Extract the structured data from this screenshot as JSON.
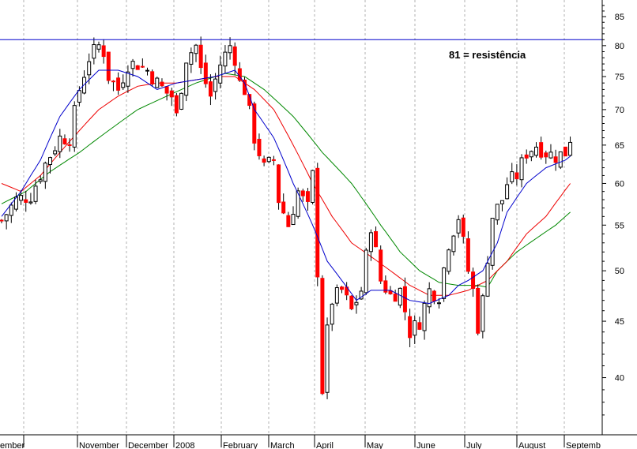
{
  "chart_data": {
    "type": "candlestick",
    "title": "",
    "xlabel": "",
    "ylabel": "",
    "y_scale": "log",
    "ylim": [
      35.5,
      88
    ],
    "grid": {
      "vertical": true,
      "horizontal": false
    },
    "y_ticks": [
      40,
      45,
      50,
      55,
      60,
      65,
      70,
      75,
      80,
      85
    ],
    "x_labels": [
      "ember",
      "November",
      "December",
      "2008",
      "February",
      "March",
      "April",
      "May",
      "June",
      "July",
      "August",
      "Septemb"
    ],
    "resistance": {
      "value": 81,
      "color": "#0000cc"
    },
    "annotation": "81 = resistência",
    "colors": {
      "up": "#ffffff",
      "down": "#ff0000",
      "candle_outline": "#000000",
      "ma_short": "#0000cc",
      "ma_mid": "#ee0000",
      "ma_long": "#008800"
    },
    "close_path": [
      [
        0,
        55.5
      ],
      [
        3,
        58
      ],
      [
        6,
        58.5
      ],
      [
        9,
        62.5
      ],
      [
        12,
        66
      ],
      [
        14,
        66
      ],
      [
        16,
        73
      ],
      [
        18,
        78
      ],
      [
        20,
        80
      ],
      [
        21,
        79
      ],
      [
        22,
        75
      ],
      [
        24,
        73
      ],
      [
        26,
        77
      ],
      [
        28,
        77
      ],
      [
        30,
        76
      ],
      [
        32,
        74
      ],
      [
        34,
        72.5
      ],
      [
        35,
        72
      ],
      [
        36,
        69
      ],
      [
        38,
        78
      ],
      [
        40,
        80
      ],
      [
        41,
        76
      ],
      [
        43,
        72
      ],
      [
        45,
        77
      ],
      [
        47,
        80
      ],
      [
        48,
        78
      ],
      [
        49,
        74
      ],
      [
        50,
        73
      ],
      [
        52,
        66
      ],
      [
        54,
        62
      ],
      [
        56,
        63
      ],
      [
        57,
        58
      ],
      [
        59,
        55
      ],
      [
        61,
        59
      ],
      [
        63,
        57
      ],
      [
        64,
        61
      ],
      [
        65,
        50
      ],
      [
        66,
        39
      ],
      [
        67,
        44
      ],
      [
        68,
        47
      ],
      [
        70,
        48
      ],
      [
        72,
        46
      ],
      [
        74,
        48
      ],
      [
        76,
        55
      ],
      [
        78,
        49
      ],
      [
        80,
        47.5
      ],
      [
        82,
        48
      ],
      [
        84,
        44
      ],
      [
        86,
        45
      ],
      [
        88,
        48
      ],
      [
        90,
        47.5
      ],
      [
        92,
        53
      ],
      [
        94,
        56
      ],
      [
        96,
        50
      ],
      [
        97,
        48
      ],
      [
        98,
        44.5
      ],
      [
        99,
        47
      ],
      [
        101,
        56
      ],
      [
        103,
        58
      ],
      [
        104,
        60
      ],
      [
        106,
        61
      ],
      [
        108,
        64
      ],
      [
        110,
        65
      ],
      [
        112,
        64
      ],
      [
        114,
        63.5
      ],
      [
        116,
        64
      ],
      [
        117,
        66
      ]
    ],
    "ma_short_path": [
      [
        0,
        56
      ],
      [
        4,
        59
      ],
      [
        8,
        63
      ],
      [
        12,
        69
      ],
      [
        16,
        73
      ],
      [
        20,
        76
      ],
      [
        24,
        76
      ],
      [
        28,
        75
      ],
      [
        32,
        73
      ],
      [
        36,
        74
      ],
      [
        40,
        74.5
      ],
      [
        44,
        75
      ],
      [
        48,
        76
      ],
      [
        50,
        74
      ],
      [
        52,
        70
      ],
      [
        56,
        66
      ],
      [
        60,
        60
      ],
      [
        64,
        55
      ],
      [
        67,
        51
      ],
      [
        70,
        49
      ],
      [
        73,
        47
      ],
      [
        76,
        48
      ],
      [
        80,
        48
      ],
      [
        84,
        47
      ],
      [
        88,
        46.7
      ],
      [
        92,
        47.5
      ],
      [
        94,
        48.5
      ],
      [
        96,
        49
      ],
      [
        99,
        50
      ],
      [
        102,
        53
      ],
      [
        104,
        56.5
      ],
      [
        108,
        60
      ],
      [
        112,
        62
      ],
      [
        116,
        63
      ],
      [
        117,
        63.5
      ]
    ],
    "ma_mid_path": [
      [
        0,
        60
      ],
      [
        4,
        59
      ],
      [
        8,
        61
      ],
      [
        12,
        64
      ],
      [
        16,
        67
      ],
      [
        20,
        70
      ],
      [
        24,
        72
      ],
      [
        28,
        73.5
      ],
      [
        32,
        74
      ],
      [
        36,
        74
      ],
      [
        40,
        74.5
      ],
      [
        44,
        75
      ],
      [
        48,
        75
      ],
      [
        52,
        73
      ],
      [
        56,
        70
      ],
      [
        60,
        65
      ],
      [
        64,
        60
      ],
      [
        68,
        56
      ],
      [
        72,
        53
      ],
      [
        76,
        51.5
      ],
      [
        80,
        50
      ],
      [
        84,
        48.5
      ],
      [
        88,
        47.5
      ],
      [
        92,
        47.5
      ],
      [
        96,
        48
      ],
      [
        100,
        49
      ],
      [
        104,
        51
      ],
      [
        108,
        54
      ],
      [
        112,
        56
      ],
      [
        117,
        60
      ]
    ],
    "ma_long_path": [
      [
        0,
        57.5
      ],
      [
        5,
        59
      ],
      [
        10,
        61.5
      ],
      [
        16,
        64
      ],
      [
        22,
        67
      ],
      [
        28,
        70
      ],
      [
        34,
        72
      ],
      [
        40,
        74
      ],
      [
        46,
        75.5
      ],
      [
        50,
        75
      ],
      [
        54,
        73
      ],
      [
        60,
        69
      ],
      [
        66,
        64
      ],
      [
        72,
        60
      ],
      [
        78,
        55
      ],
      [
        82,
        52
      ],
      [
        86,
        50
      ],
      [
        90,
        48.8
      ],
      [
        94,
        48.5
      ],
      [
        98,
        48.5
      ],
      [
        100,
        48.3
      ],
      [
        102,
        50
      ],
      [
        106,
        52
      ],
      [
        110,
        53.5
      ],
      [
        114,
        55
      ],
      [
        117,
        56.5
      ]
    ]
  }
}
